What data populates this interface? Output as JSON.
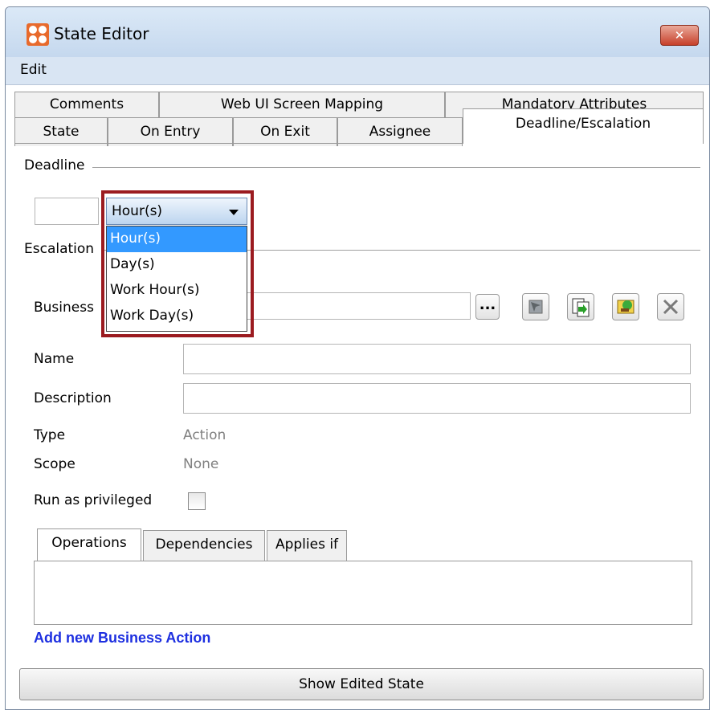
{
  "window": {
    "title": "State Editor",
    "close_glyph": "✕"
  },
  "menu": {
    "edit": "Edit"
  },
  "tabs": {
    "back_row": [
      "Comments",
      "Web UI Screen Mapping",
      "Mandatory Attributes"
    ],
    "front_row": [
      "State",
      "On Entry",
      "On Exit",
      "Assignee",
      "Deadline/Escalation"
    ],
    "active": "Deadline/Escalation"
  },
  "deadline": {
    "group_label": "Deadline",
    "value": "",
    "unit_selected": "Hour(s)",
    "unit_options": [
      "Hour(s)",
      "Day(s)",
      "Work Hour(s)",
      "Work Day(s)"
    ]
  },
  "escalation": {
    "group_label": "Escalation",
    "business_action_label": "Business",
    "browse_label": "...",
    "name_label": "Name",
    "name_value": "",
    "description_label": "Description",
    "description_value": "",
    "type_label": "Type",
    "type_value": "Action",
    "scope_label": "Scope",
    "scope_value": "None",
    "run_privileged_label": "Run as privileged",
    "run_privileged_checked": false
  },
  "subtabs": [
    "Operations",
    "Dependencies",
    "Applies if"
  ],
  "add_link": "Add new Business Action",
  "show_button": "Show Edited State",
  "icons": [
    "select-icon",
    "copy-icon",
    "edit-icon",
    "delete-icon"
  ],
  "colors": {
    "highlight": "#9b1b20",
    "selection": "#3399ff",
    "link": "#1d2fe0"
  }
}
